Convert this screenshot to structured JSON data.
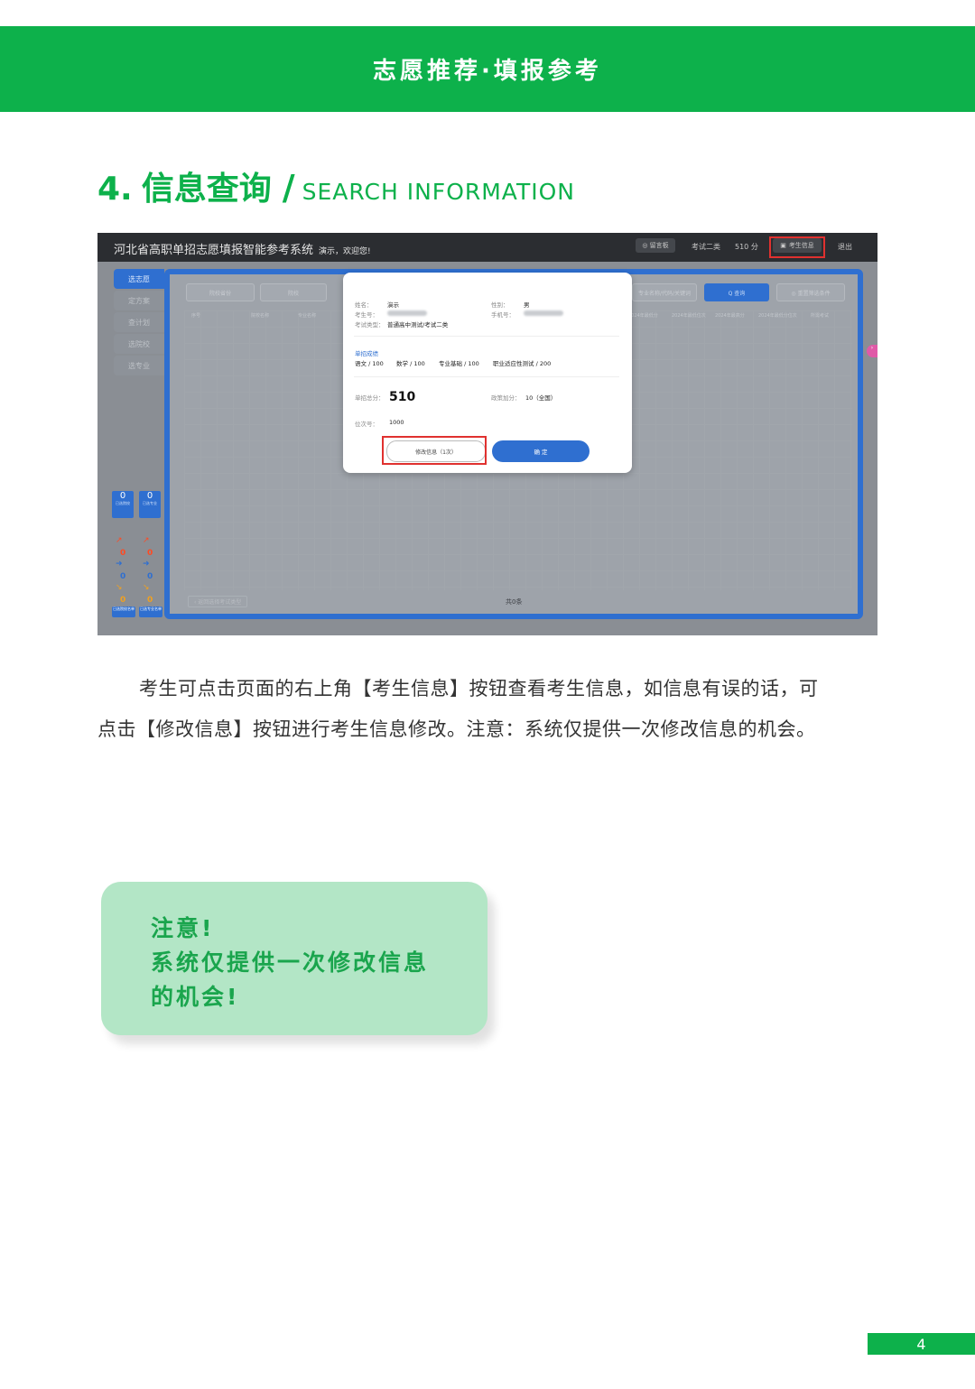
{
  "banner": {
    "title": "志愿推荐·填报参考"
  },
  "section": {
    "number": "4.",
    "title_cn": "信息查询",
    "slash": "/",
    "title_en": "SEARCH INFORMATION"
  },
  "screenshot": {
    "app_title": "河北省高职单招志愿填报智能参考系统",
    "welcome": "演示，欢迎您!",
    "top_items": {
      "notice": "◎ 留言板",
      "exam_type": "考试二类",
      "score": "510 分",
      "student_info": "考生信息",
      "logout": "退出"
    },
    "sidebar": [
      "选志愿",
      "定方案",
      "查计划",
      "选院校",
      "选专业"
    ],
    "filters": [
      "院校省份",
      "院校",
      "专业名称/代码/关键词"
    ],
    "buttons": {
      "search": "Q 查询",
      "reset": "◎ 重置筛选条件"
    },
    "columns": [
      "序号",
      "院校名称",
      "专业名称",
      "2024年最低分",
      "2024年最低位次",
      "2024年最高分",
      "2024年最低分位次",
      "所需考试"
    ],
    "stats": {
      "boxes": [
        {
          "value": "0",
          "label": "已选院校"
        },
        {
          "value": "0",
          "label": "已选专业"
        }
      ],
      "counts": [
        "0",
        "0",
        "0",
        "0",
        "0",
        "0"
      ],
      "bottom": [
        "已选院校名单",
        "已选专业名单"
      ]
    },
    "footer_left": "‹ 返回选择考试类型",
    "footer_center": "共0条",
    "modal": {
      "name_label": "姓名：",
      "name": "演示",
      "gender_label": "性别：",
      "gender": "男",
      "exam_no_label": "考生号：",
      "phone_label": "手机号：",
      "type_label": "考试类型：",
      "type": "普通高中测试/考试二类",
      "scores_title": "单招成绩",
      "scores": [
        "语文 / 100",
        "数学 / 100",
        "专业基础 / 100",
        "职业适应性测试 / 200"
      ],
      "total_label": "单招总分：",
      "total": "510",
      "bonus_label": "政策加分：",
      "bonus": "10（全国）",
      "rank_label": "位次号：",
      "rank": "1000",
      "modify_button": "修改信息（1次）",
      "confirm_button": "确 定"
    }
  },
  "paragraph": {
    "line1": "考生可点击页面的右上角【考生信息】按钮查看考生信息，如信息有误的话，可",
    "line2": "点击【修改信息】按钮进行考生信息修改。注意：系统仅提供一次修改信息的机会。"
  },
  "note": {
    "line1": "注意!",
    "line2": "系统仅提供一次修改信息",
    "line3": "的机会!"
  },
  "page_number": "4",
  "colors": {
    "brand_green": "#0db14b",
    "note_bg": "#b3e6c6",
    "system_blue": "#2f6fd0",
    "highlight_red": "#e0312f"
  }
}
